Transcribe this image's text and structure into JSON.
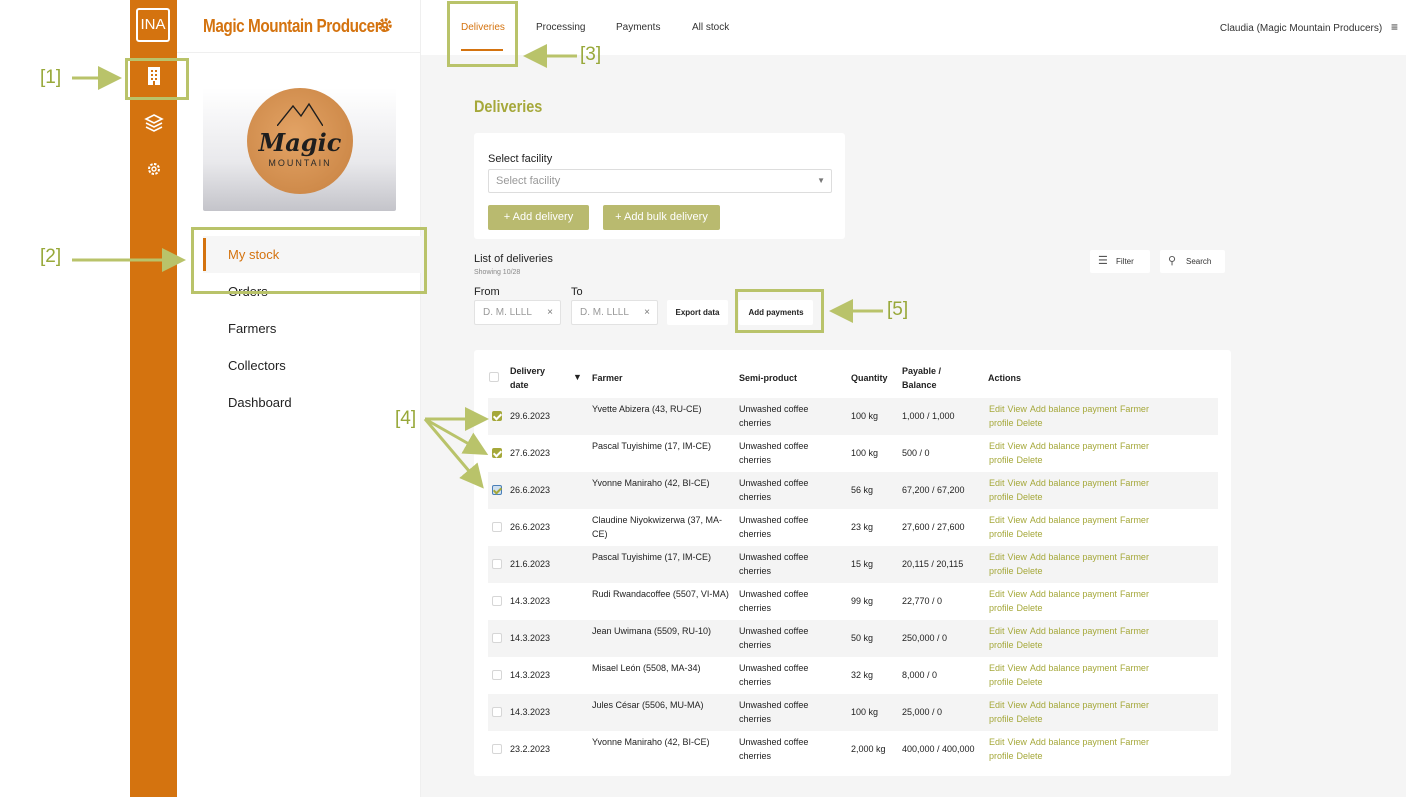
{
  "app": {
    "rail_logo": "INA",
    "org_name": "Magic Mountain Producers",
    "brand_word": "Magic",
    "brand_sub": "MOUNTAIN"
  },
  "sidebar": {
    "items": [
      {
        "label": "My stock",
        "active": true
      },
      {
        "label": "Orders"
      },
      {
        "label": "Farmers"
      },
      {
        "label": "Collectors"
      },
      {
        "label": "Dashboard"
      }
    ]
  },
  "tabs": [
    "Deliveries",
    "Processing",
    "Payments",
    "All stock"
  ],
  "user": "Claudia (Magic Mountain Producers)",
  "page_title": "Deliveries",
  "facility": {
    "label": "Select facility",
    "placeholder": "Select facility",
    "add_delivery": "+ Add delivery",
    "add_bulk_delivery": "+ Add bulk delivery"
  },
  "list": {
    "title": "List of deliveries",
    "showing": "Showing 10/28",
    "filter": "Filter",
    "search": "Search",
    "from_label": "From",
    "to_label": "To",
    "from_placeholder": "D. M. LLLL",
    "to_placeholder": "D. M. LLLL",
    "export_data": "Export data",
    "add_payments": "Add payments"
  },
  "table": {
    "headers": {
      "delivery_date": "Delivery date",
      "farmer": "Farmer",
      "semi_product": "Semi-product",
      "quantity": "Quantity",
      "payable_balance": "Payable / Balance",
      "actions": "Actions"
    },
    "action_labels": [
      "Edit",
      "View",
      "Add balance payment",
      "Farmer profile",
      "Delete"
    ],
    "rows": [
      {
        "checked": "on",
        "date": "29.6.2023",
        "farmer": "Yvette Abizera (43, RU-CE)",
        "semi_product": "Unwashed coffee cherries",
        "quantity": "100 kg",
        "payable": "1,000 / 1,000"
      },
      {
        "checked": "on",
        "date": "27.6.2023",
        "farmer": "Pascal Tuyishime (17, IM-CE)",
        "semi_product": "Unwashed coffee cherries",
        "quantity": "100 kg",
        "payable": "500 / 0"
      },
      {
        "checked": "partial",
        "date": "26.6.2023",
        "farmer": "Yvonne Maniraho (42, BI-CE)",
        "semi_product": "Unwashed coffee cherries",
        "quantity": "56 kg",
        "payable": "67,200 / 67,200"
      },
      {
        "checked": "off",
        "date": "26.6.2023",
        "farmer": "Claudine Niyokwizerwa (37, MA-CE)",
        "semi_product": "Unwashed coffee cherries",
        "quantity": "23 kg",
        "payable": "27,600 / 27,600"
      },
      {
        "checked": "off",
        "date": "21.6.2023",
        "farmer": "Pascal Tuyishime (17, IM-CE)",
        "semi_product": "Unwashed coffee cherries",
        "quantity": "15 kg",
        "payable": "20,115 / 20,115"
      },
      {
        "checked": "off",
        "date": "14.3.2023",
        "farmer": "Rudi Rwandacoffee (5507, VI-MA)",
        "semi_product": "Unwashed coffee cherries",
        "quantity": "99 kg",
        "payable": "22,770 / 0"
      },
      {
        "checked": "off",
        "date": "14.3.2023",
        "farmer": "Jean Uwimana (5509, RU-10)",
        "semi_product": "Unwashed coffee cherries",
        "quantity": "50 kg",
        "payable": "250,000 / 0"
      },
      {
        "checked": "off",
        "date": "14.3.2023",
        "farmer": "Misael León (5508, MA-34)",
        "semi_product": "Unwashed coffee cherries",
        "quantity": "32 kg",
        "payable": "8,000 / 0"
      },
      {
        "checked": "off",
        "date": "14.3.2023",
        "farmer": "Jules César (5506, MU-MA)",
        "semi_product": "Unwashed coffee cherries",
        "quantity": "100 kg",
        "payable": "25,000 / 0"
      },
      {
        "checked": "off",
        "date": "23.2.2023",
        "farmer": "Yvonne Maniraho (42, BI-CE)",
        "semi_product": "Unwashed coffee cherries",
        "quantity": "2,000 kg",
        "payable": "400,000 / 400,000"
      }
    ]
  },
  "annotations": [
    "[1]",
    "[2]",
    "[3]",
    "[4]",
    "[5]"
  ],
  "colors": {
    "accent": "#d4730f",
    "olive": "#a5a83a",
    "annotation": "#b9c36a"
  }
}
